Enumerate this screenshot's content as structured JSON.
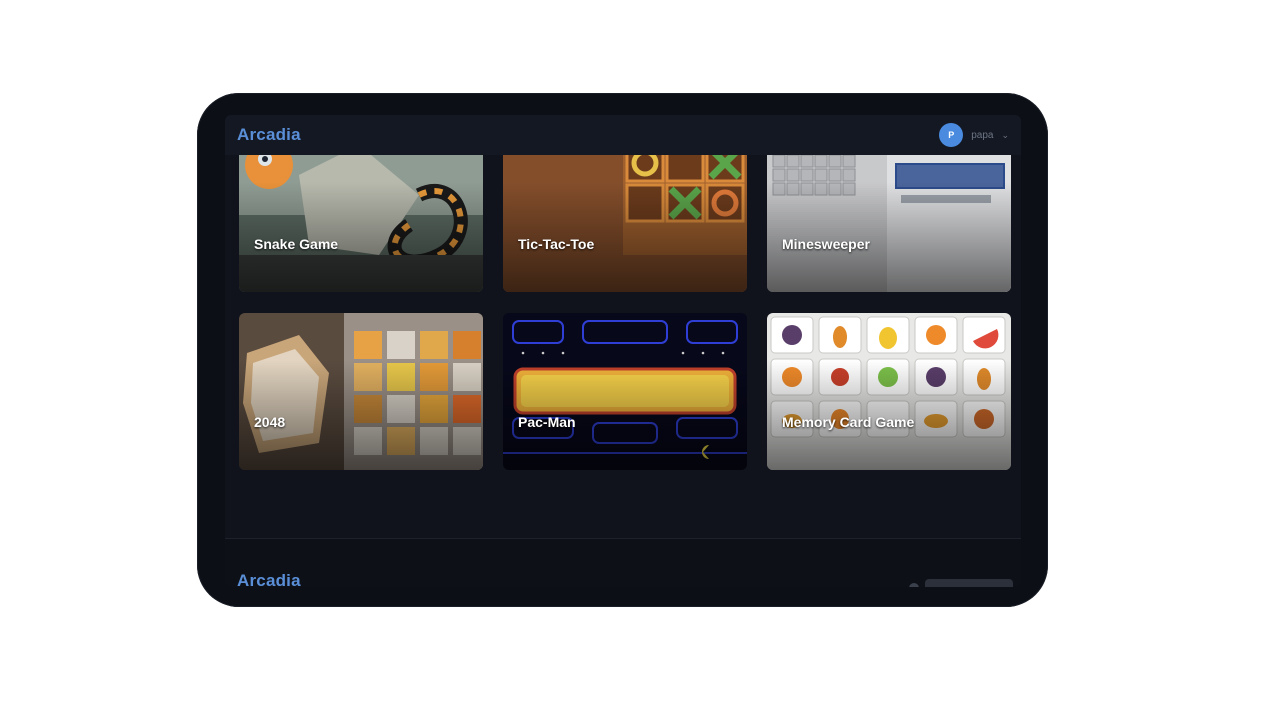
{
  "header": {
    "logo": "Arcadia",
    "user": {
      "initial": "P",
      "name": "papa"
    }
  },
  "games": [
    {
      "title": "Snake Game"
    },
    {
      "title": "Tic-Tac-Toe"
    },
    {
      "title": "Minesweeper"
    },
    {
      "title": "2048"
    },
    {
      "title": "Pac-Man"
    },
    {
      "title": "Memory Card Game"
    }
  ],
  "footer": {
    "logo": "Arcadia"
  },
  "colors": {
    "brand": "#5a8fd8",
    "avatar": "#4a8be0",
    "background": "#10131b"
  }
}
